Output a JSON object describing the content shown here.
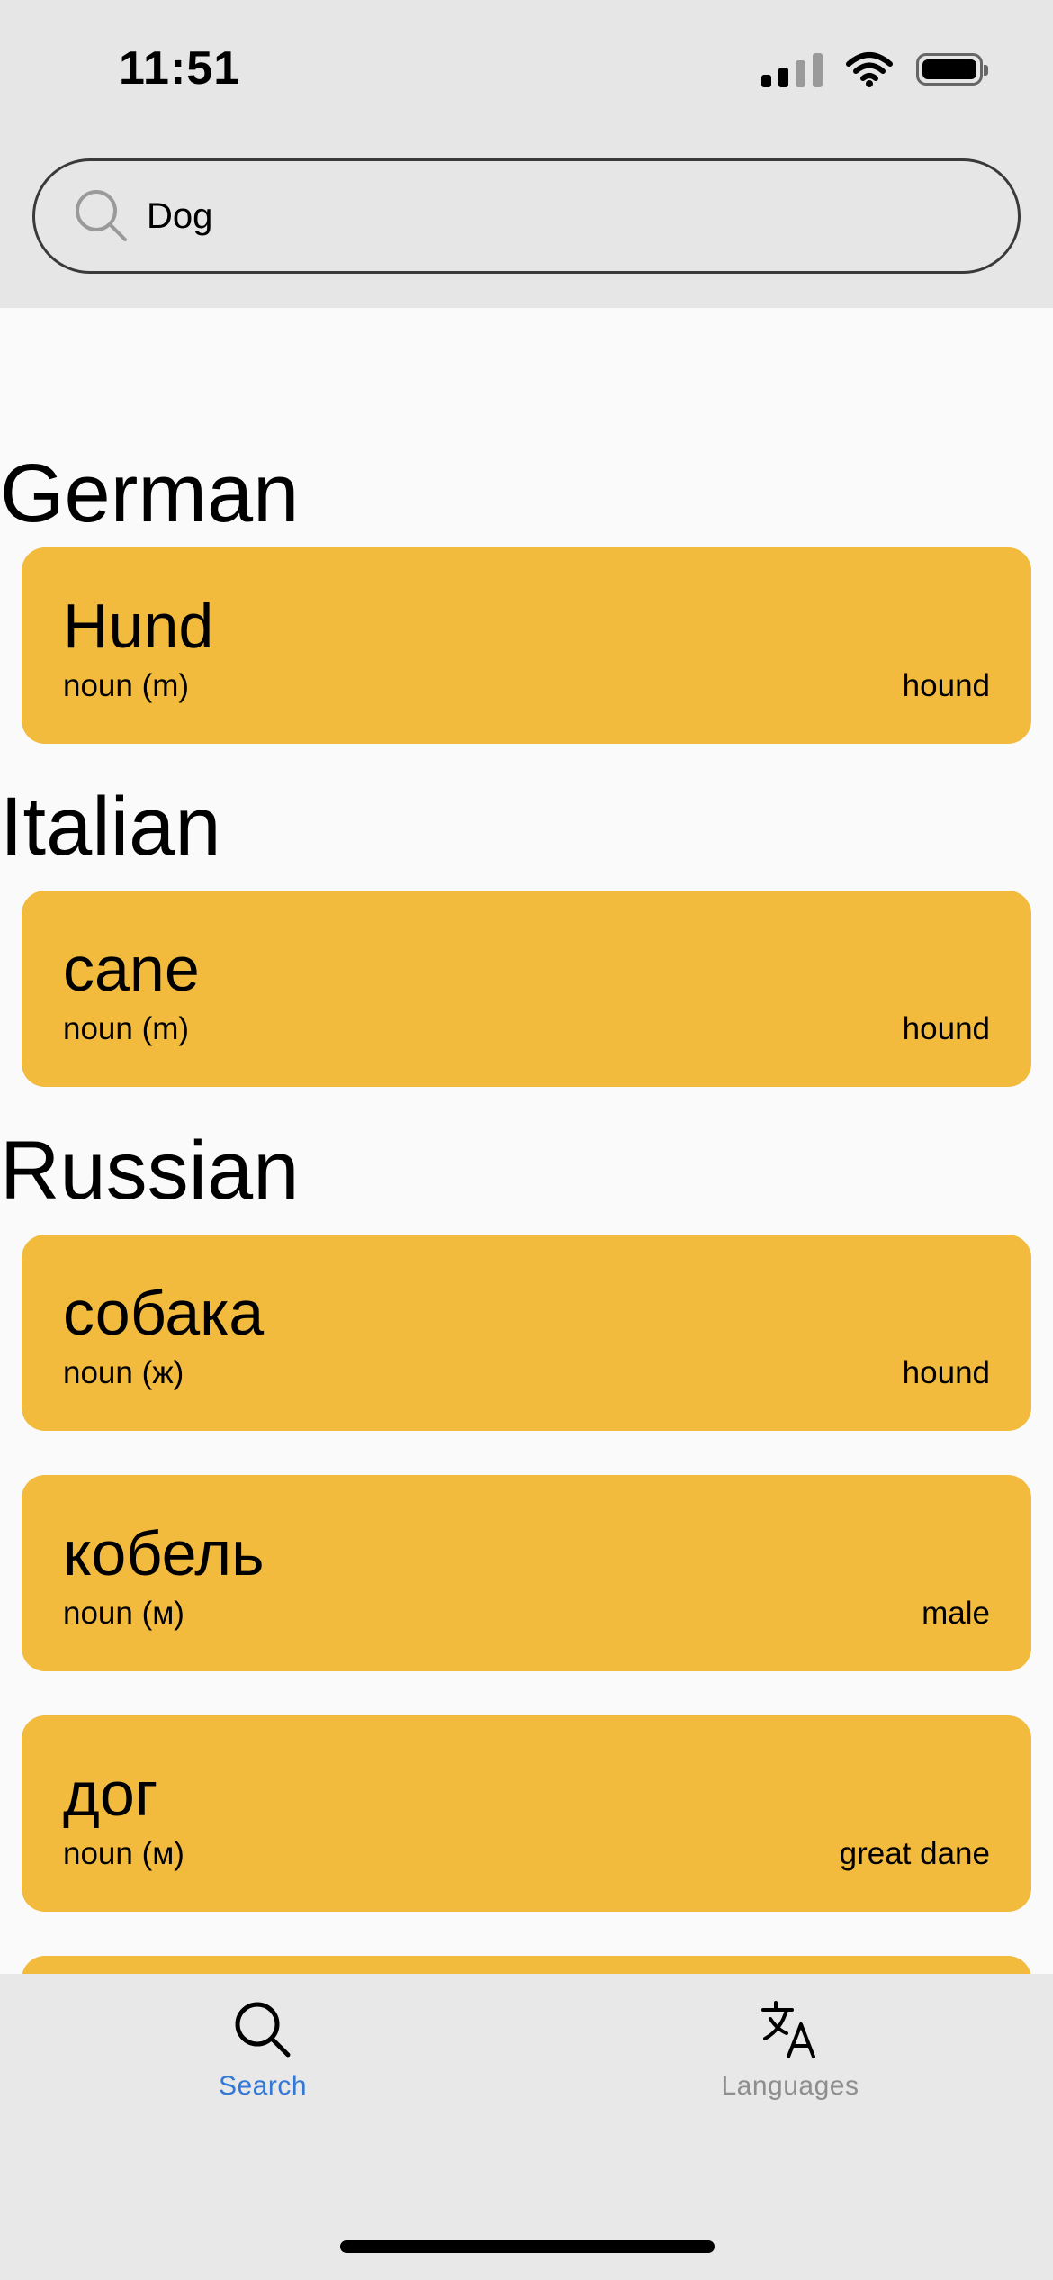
{
  "status_bar": {
    "time": "11:51",
    "icons": [
      "cellular-signal-icon",
      "wifi-icon",
      "battery-icon"
    ]
  },
  "search": {
    "value": "Dog",
    "icon": "search-icon"
  },
  "sections": {
    "german": {
      "title": "German",
      "entries": [
        {
          "word": "Hund",
          "pos": "noun (m)",
          "meaning": "hound"
        }
      ]
    },
    "italian": {
      "title": "Italian",
      "entries": [
        {
          "word": "cane",
          "pos": "noun (m)",
          "meaning": "hound"
        }
      ]
    },
    "russian": {
      "title": "Russian",
      "entries": [
        {
          "word": "собака",
          "pos": "noun (ж)",
          "meaning": "hound"
        },
        {
          "word": "кобель",
          "pos": "noun (м)",
          "meaning": "male"
        },
        {
          "word": "дог",
          "pos": "noun (м)",
          "meaning": "great dane"
        }
      ]
    }
  },
  "tabbar": {
    "search_label": "Search",
    "languages_label": "Languages",
    "active": "search"
  },
  "colors": {
    "card": "#F2BB3E",
    "active_tab": "#3478D6",
    "inactive_tab": "#8E8E8E",
    "header_bg": "#E6E6E6"
  }
}
